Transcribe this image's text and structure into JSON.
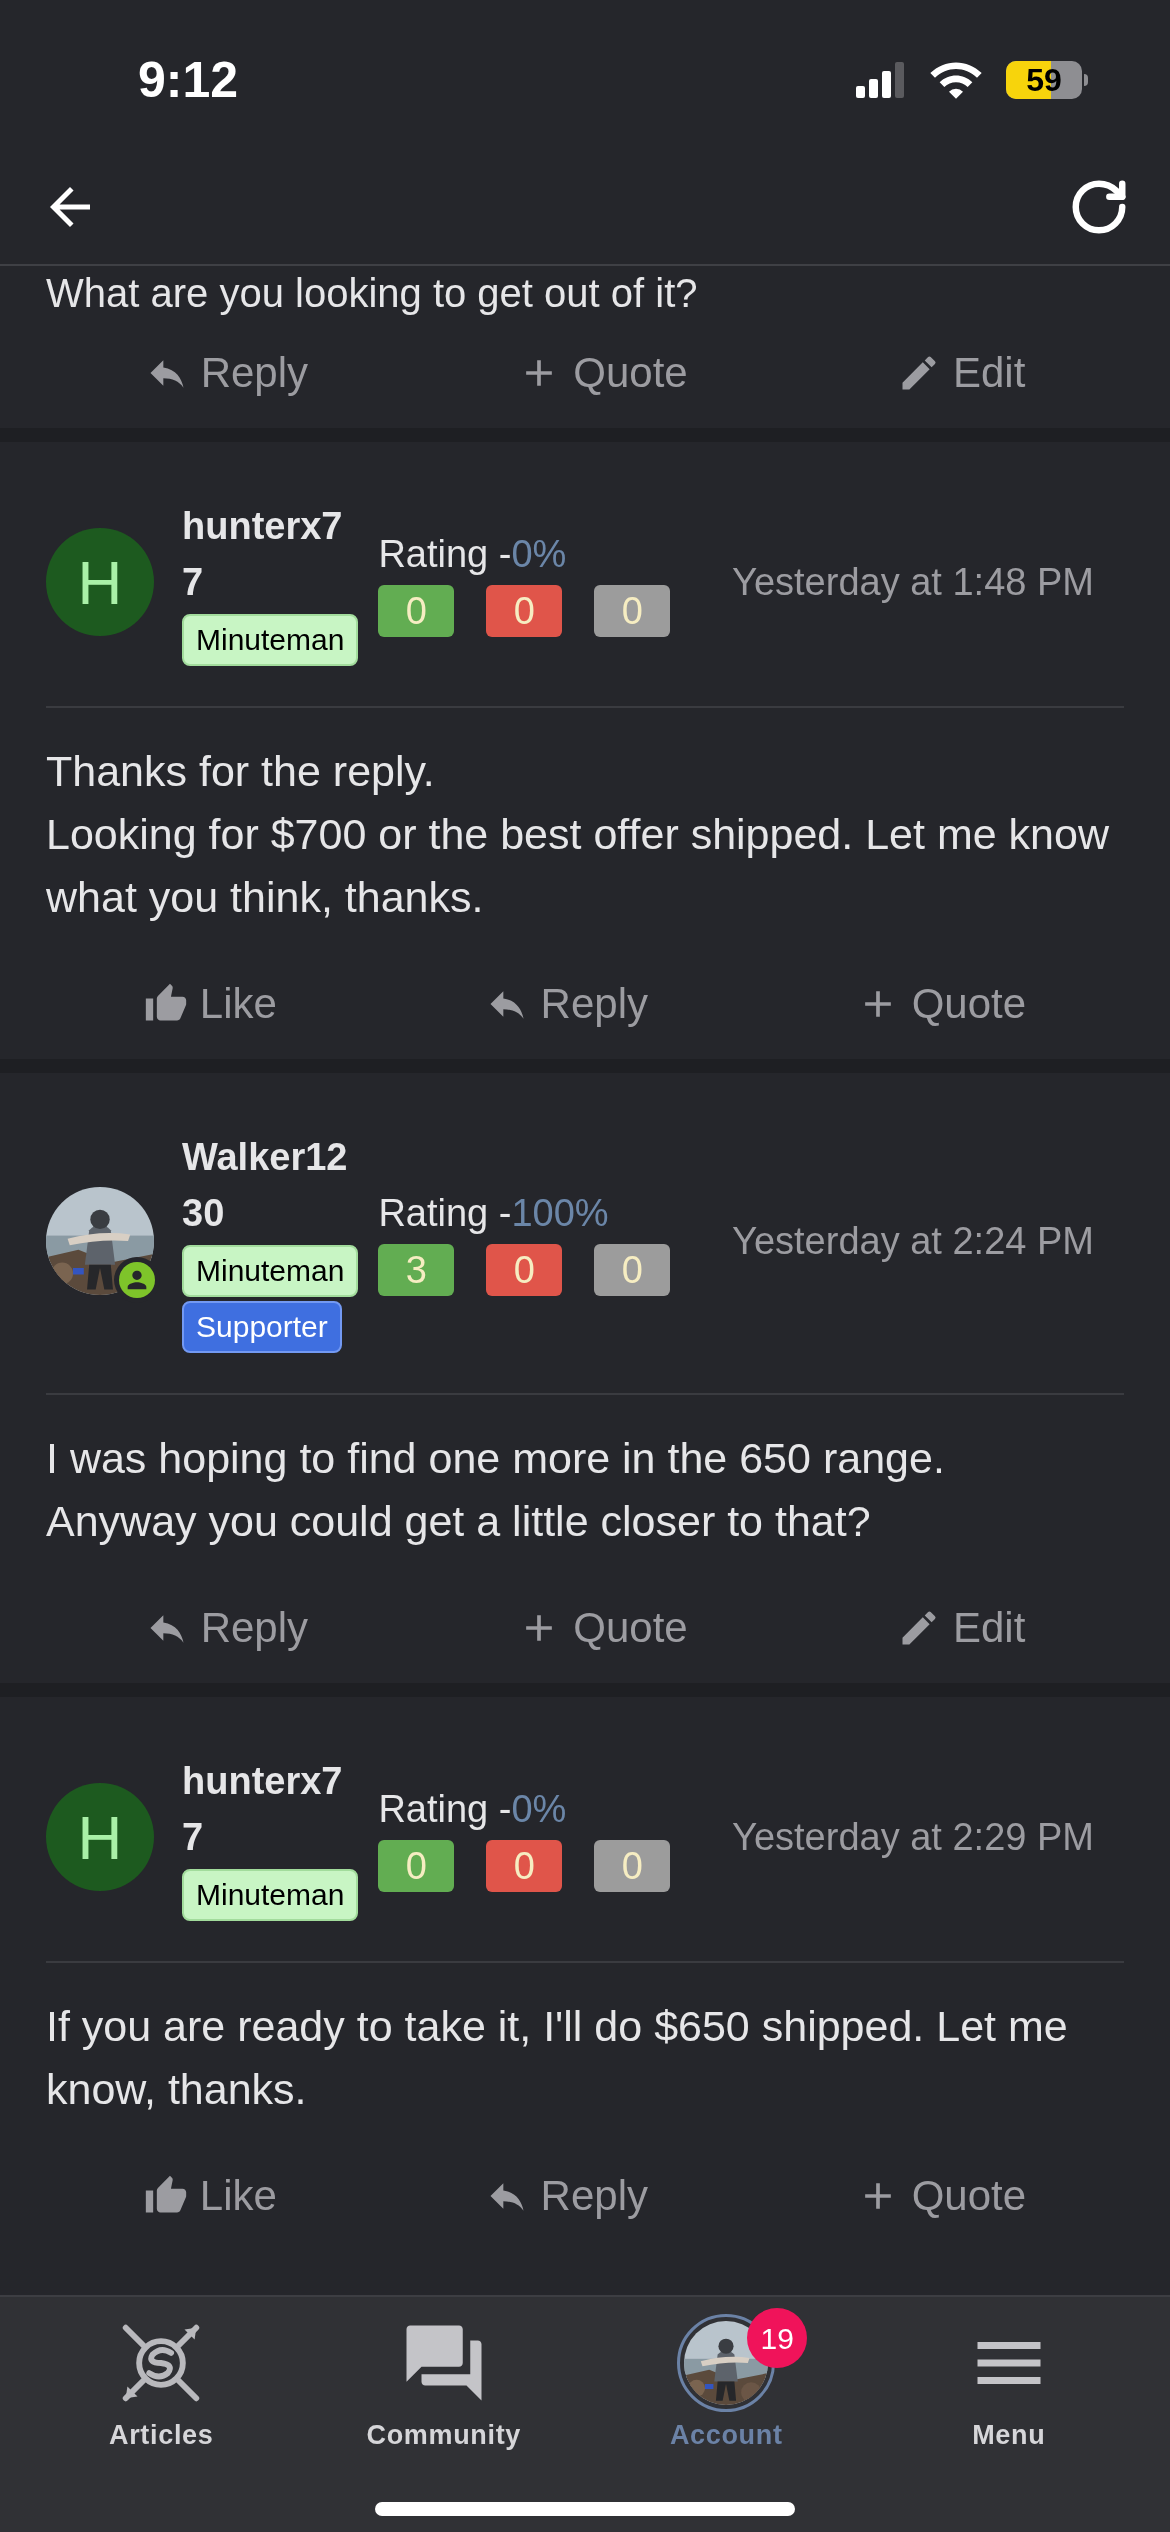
{
  "status_bar": {
    "time": "9:12",
    "battery": "59"
  },
  "posts": [
    {
      "kind": "fragment",
      "body": "What are you looking to get out of it?",
      "actions": [
        {
          "kind": "reply",
          "label": "Reply"
        },
        {
          "kind": "quote",
          "label": "Quote"
        },
        {
          "kind": "edit",
          "label": "Edit"
        }
      ]
    },
    {
      "kind": "post",
      "author": {
        "name": "hunterx77",
        "kind": "letter",
        "initial": "H",
        "online": false
      },
      "badges": [
        {
          "kind": "minuteman",
          "label": "Minuteman"
        }
      ],
      "rating_label": "Rating -",
      "rating_value": "0%",
      "votes": [
        {
          "kind": "positive",
          "count": "0"
        },
        {
          "kind": "negative",
          "count": "0"
        },
        {
          "kind": "neutral",
          "count": "0"
        }
      ],
      "time": "Yesterday at 1:48 PM",
      "body": "Thanks for the reply.\nLooking for $700 or the best offer shipped. Let me know what you think, thanks.",
      "actions": [
        {
          "kind": "like",
          "label": "Like"
        },
        {
          "kind": "reply",
          "label": "Reply"
        },
        {
          "kind": "quote",
          "label": "Quote"
        }
      ]
    },
    {
      "kind": "post",
      "author": {
        "name": "Walker1230",
        "online": true
      },
      "badges": [
        {
          "kind": "minuteman",
          "label": "Minuteman"
        },
        {
          "kind": "supporter",
          "label": "Supporter"
        }
      ],
      "rating_label": "Rating -",
      "rating_value": "100%",
      "votes": [
        {
          "kind": "positive",
          "count": "3"
        },
        {
          "kind": "negative",
          "count": "0"
        },
        {
          "kind": "neutral",
          "count": "0"
        }
      ],
      "time": "Yesterday at 2:24 PM",
      "body": "I was hoping to find one more in the 650 range.\nAnyway you could get a little closer to that?",
      "actions": [
        {
          "kind": "reply",
          "label": "Reply"
        },
        {
          "kind": "quote",
          "label": "Quote"
        },
        {
          "kind": "edit",
          "label": "Edit"
        }
      ]
    },
    {
      "kind": "post",
      "author": {
        "name": "hunterx77",
        "kind": "letter",
        "initial": "H",
        "online": false
      },
      "badges": [
        {
          "kind": "minuteman",
          "label": "Minuteman"
        }
      ],
      "rating_label": "Rating -",
      "rating_value": "0%",
      "votes": [
        {
          "kind": "positive",
          "count": "0"
        },
        {
          "kind": "negative",
          "count": "0"
        },
        {
          "kind": "neutral",
          "count": "0"
        }
      ],
      "time": "Yesterday at 2:29 PM",
      "body": "If you are ready to take it, I'll do $650 shipped. Let me know, thanks.",
      "actions": [
        {
          "kind": "like",
          "label": "Like"
        },
        {
          "kind": "reply",
          "label": "Reply"
        },
        {
          "kind": "quote",
          "label": "Quote"
        }
      ]
    }
  ],
  "tab_bar": [
    {
      "kind": "logo",
      "label": "Articles",
      "selected": false
    },
    {
      "kind": "chat",
      "label": "Community",
      "selected": false
    },
    {
      "kind": "avatar",
      "label": "Account",
      "selected": true,
      "badge": "19"
    },
    {
      "kind": "menu",
      "label": "Menu",
      "selected": false
    }
  ]
}
